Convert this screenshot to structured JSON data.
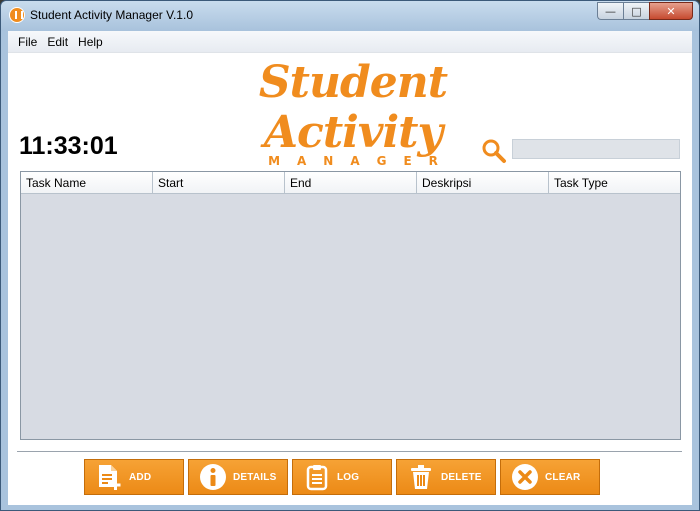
{
  "window": {
    "title": "Student Activity Manager V.1.0"
  },
  "menu": [
    "File",
    "Edit",
    "Help"
  ],
  "logo": {
    "main": "Student Activity",
    "sub": "MANAGER"
  },
  "clock": "11:33:01",
  "search": {
    "value": "",
    "placeholder": ""
  },
  "table": {
    "columns": [
      "Task Name",
      "Start",
      "End",
      "Deskripsi",
      "Task Type"
    ],
    "rows": []
  },
  "buttons": {
    "add": "ADD",
    "details": "DETAILS",
    "log": "LOG",
    "delete": "DELETE",
    "clear": "CLEAR"
  },
  "colors": {
    "accent": "#f08c1e",
    "table_bg": "#d7dbe3"
  }
}
